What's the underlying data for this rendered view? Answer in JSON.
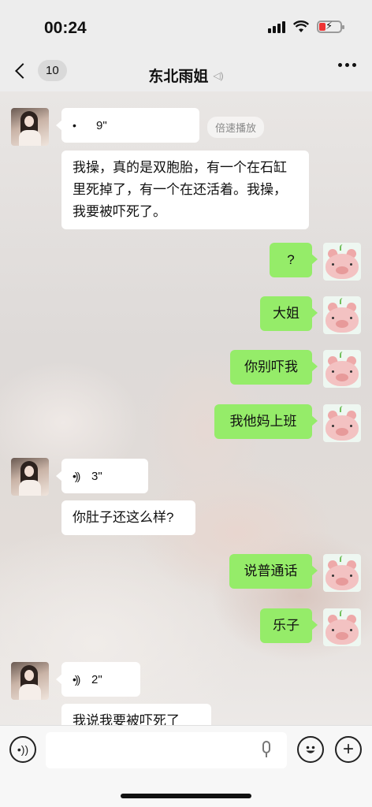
{
  "status": {
    "time": "00:24"
  },
  "nav": {
    "unread_count": "10",
    "title": "东北雨姐"
  },
  "messages": {
    "m1_voice_duration": "9\"",
    "m1_speed_label": "倍速播放",
    "m2_text": "我操，真的是双胞胎，有一个在石缸里死掉了，有一个在还活着。我操，我要被吓死了。",
    "m3_text": "?",
    "m4_text": "大姐",
    "m5_text": "你别吓我",
    "m6_text": "我他妈上班",
    "m7_voice_duration": "3\"",
    "m8_text": "你肚子还这么样?",
    "m9_text": "说普通话",
    "m10_text": "乐子",
    "m11_voice_duration": "2\"",
    "m12_text": "我说我要被吓死了"
  },
  "icons": {
    "back": "chevron-left-icon",
    "more": "more-dots-icon",
    "voice": "voice-wave-icon",
    "mic": "microphone-icon",
    "emoji": "emoji-icon",
    "plus": "plus-icon"
  },
  "colors": {
    "sent_bubble": "#95ec69",
    "received_bubble": "#ffffff",
    "battery_low": "#e33333"
  }
}
